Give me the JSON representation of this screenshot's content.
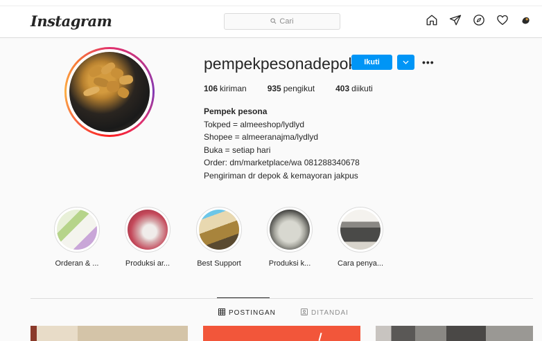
{
  "header": {
    "logo": "Instagram",
    "search_placeholder": "Cari",
    "nav_icons": [
      "home-icon",
      "direct-icon",
      "explore-icon",
      "heart-icon",
      "profile-avatar-icon"
    ]
  },
  "profile": {
    "username": "pempekpesonadepok",
    "follow_label": "Ikuti",
    "stats": [
      {
        "count": "106",
        "label": "kiriman"
      },
      {
        "count": "935",
        "label": "pengikut"
      },
      {
        "count": "403",
        "label": "diikuti"
      }
    ],
    "bio": {
      "name": "Pempek pesona",
      "lines": [
        "Tokped = almeeshop/lydlyd",
        "Shopee = almeeranajma/lydlyd",
        "Buka = setiap hari",
        "Order: dm/marketplace/wa 081288340678",
        "Pengiriman dr depok & kemayoran jakpus"
      ]
    }
  },
  "highlights": [
    {
      "label": "Orderan & ..."
    },
    {
      "label": "Produksi ar..."
    },
    {
      "label": "Best Support"
    },
    {
      "label": "Produksi k..."
    },
    {
      "label": "Cara penya..."
    }
  ],
  "tabs": [
    {
      "label": "POSTINGAN",
      "active": true
    },
    {
      "label": "DITANDAI",
      "active": false
    }
  ],
  "colors": {
    "accent": "#0095f6",
    "text": "#262626",
    "muted": "#8e8e8e",
    "border": "#dbdbdb"
  }
}
